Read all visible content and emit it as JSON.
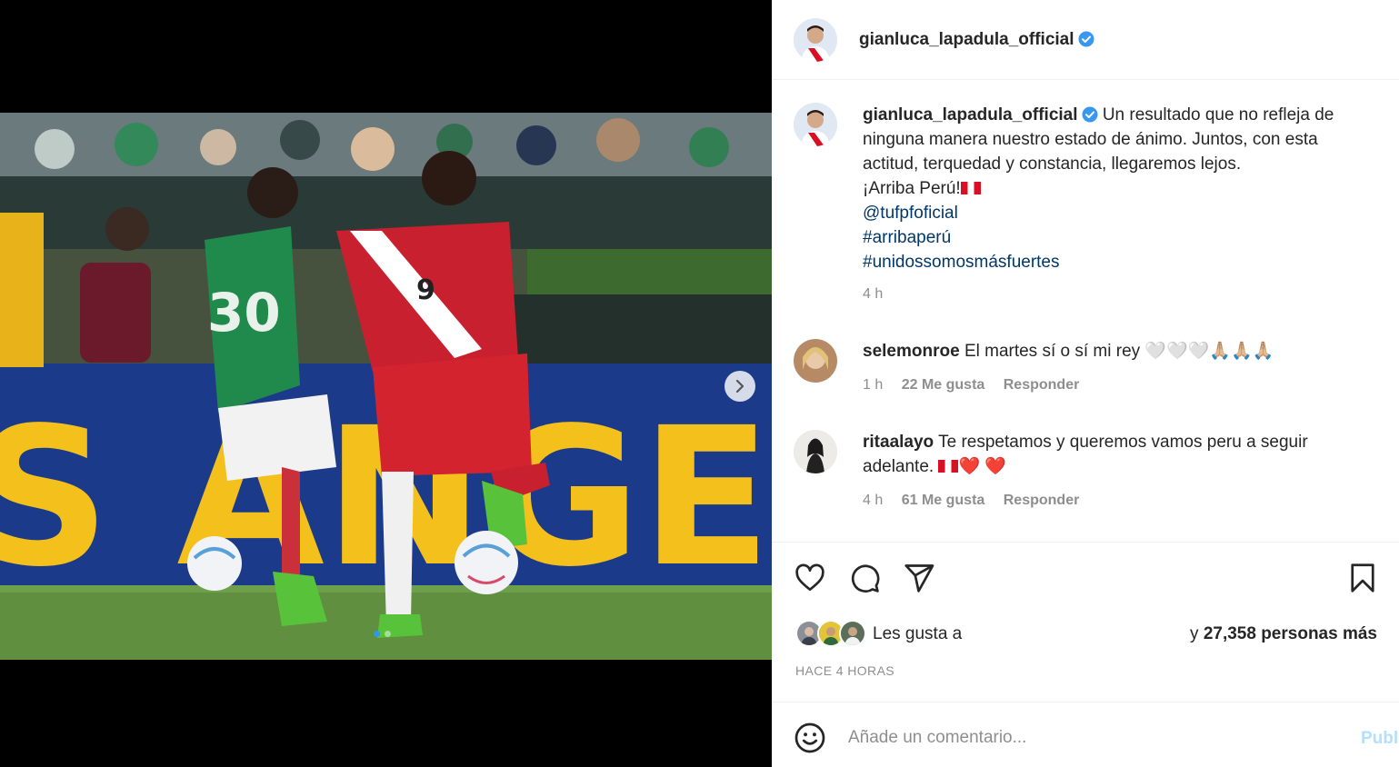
{
  "post": {
    "author": "gianluca_lapadula_official",
    "verified": true,
    "caption_lines": [
      "Un resultado que no refleja de",
      "ninguna manera nuestro estado de ánimo. Juntos, con esta",
      "actitud, terquedad y constancia, llegaremos lejos.",
      "¡Arriba Perú!"
    ],
    "mention": "@tufpfoficial",
    "hashtags": [
      "#arribaperú",
      "#unidossomosmásfuertes"
    ],
    "caption_time": "4 h"
  },
  "media": {
    "carousel_index": 1,
    "carousel_total": 2,
    "next_icon": "chevron-right-icon"
  },
  "comments": [
    {
      "username": "selemonroe",
      "text": "El martes sí o sí mi rey 🤍🤍🤍🙏🏼🙏🏼🙏🏼",
      "time": "1 h",
      "likes": "22 Me gusta",
      "reply": "Responder"
    },
    {
      "username": "ritaalayo",
      "text_line1": "Te respetamos y queremos vamos peru a seguir",
      "text_line2": "adelante.",
      "text_tail": "❤️ ❤️",
      "time": "4 h",
      "likes": "61 Me gusta",
      "reply": "Responder"
    }
  ],
  "actions": {
    "icons": [
      "heart-icon",
      "comment-icon",
      "share-icon",
      "bookmark-icon"
    ]
  },
  "likes": {
    "prefix": "Les gusta a",
    "suffix_pre": "y ",
    "count": "27,358 personas más"
  },
  "timestamp": "HACE 4 HORAS",
  "composer": {
    "placeholder": "Añade un comentario...",
    "publish": "Publicar"
  },
  "colors": {
    "link": "#00376b",
    "secondary": "#8e8e8e",
    "verified": "#3897f0",
    "publish": "#b2dffc",
    "peru_red": "#d91023",
    "mexico_green": "#1f8a4c"
  }
}
